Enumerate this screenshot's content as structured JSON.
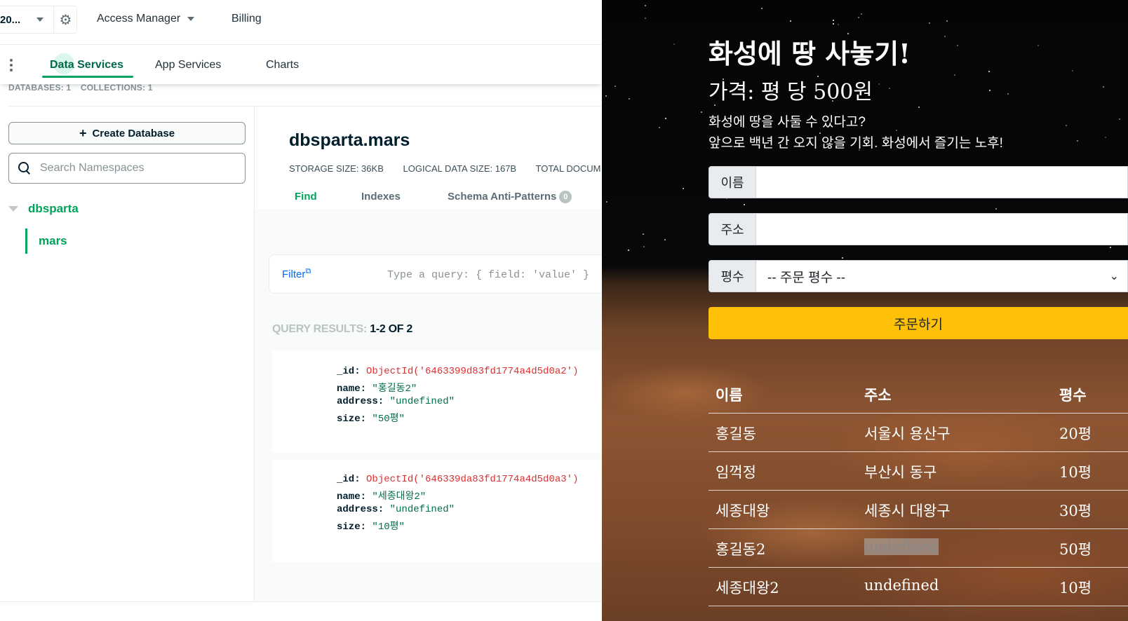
{
  "atlas": {
    "topbar": {
      "org_name": "20...",
      "access_manager": "Access Manager",
      "billing": "Billing"
    },
    "tabs": {
      "data_services": "Data Services",
      "app_services": "App Services",
      "charts": "Charts"
    },
    "stats": {
      "databases": "DATABASES: 1",
      "collections": "COLLECTIONS: 1"
    },
    "sidebar": {
      "create_db_plus": "+",
      "create_db": "Create Database",
      "search_placeholder": "Search Namespaces",
      "db_name": "dbsparta",
      "collection_name": "mars"
    },
    "collection": {
      "title": "dbsparta.mars",
      "storage_size": "STORAGE SIZE: 36KB",
      "logical_size": "LOGICAL DATA SIZE: 167B",
      "total_docs": "TOTAL DOCUM",
      "tab_find": "Find",
      "tab_indexes": "Indexes",
      "tab_schema": "Schema Anti-Patterns",
      "schema_badge": "0",
      "filter_label": "Filter",
      "filter_icon": "external-link-icon",
      "query_placeholder": "Type a query: { field: 'value' }",
      "query_results_prefix": "QUERY RESULTS:",
      "query_results_count": "1-2 OF 2"
    },
    "documents": [
      {
        "id_key": "_id:",
        "id_val": "ObjectId('6463399d83fd1774a4d5d0a2')",
        "name_key": "name:",
        "name_val": "\"홍길동2\"",
        "address_key": "address:",
        "address_val": "\"undefined\"",
        "size_key": "size:",
        "size_val": "\"50평\""
      },
      {
        "id_key": "_id:",
        "id_val": "ObjectId('646339da83fd1774a4d5d0a3')",
        "name_key": "name:",
        "name_val": "\"세종대왕2\"",
        "address_key": "address:",
        "address_val": "\"undefined\"",
        "size_key": "size:",
        "size_val": "\"10평\""
      }
    ]
  },
  "mars": {
    "title": "화성에 땅 사놓기!",
    "price": "가격: 평 당 500원",
    "desc_line1": "화성에 땅을 사둘 수 있다고?",
    "desc_line2": "앞으로 백년 간 오지 않을 기회. 화성에서 즐기는 노후!",
    "form": {
      "name_label": "이름",
      "address_label": "주소",
      "size_label": "평수",
      "size_selected": "-- 주문 평수 --",
      "order_button": "주문하기"
    },
    "table": {
      "headers": [
        "이름",
        "주소",
        "평수"
      ],
      "rows": [
        [
          "홍길동",
          "서울시 용산구",
          "20평"
        ],
        [
          "임꺽정",
          "부산시 동구",
          "10평"
        ],
        [
          "세종대왕",
          "세종시 대왕구",
          "30평"
        ],
        [
          "홍길동2",
          "undefined",
          "50평"
        ],
        [
          "세종대왕2",
          "undefined",
          "10평"
        ]
      ]
    }
  }
}
